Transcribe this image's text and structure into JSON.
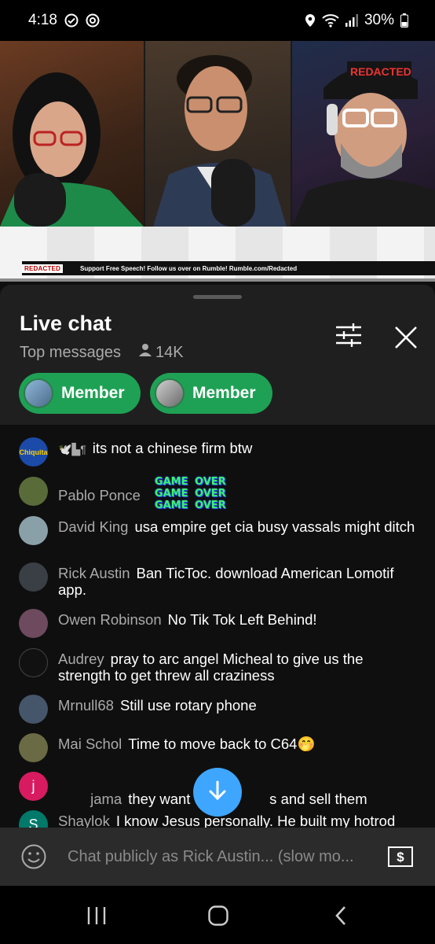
{
  "status_bar": {
    "time": "4:18",
    "battery": "30%"
  },
  "video": {
    "ticker_logo": "REDACTED",
    "ticker_text": "Support Free Speech! Follow us over on Rumble! Rumble.com/Redacted",
    "cap_text": "REDACTED"
  },
  "chat": {
    "title": "Live chat",
    "filter_label": "Top messages",
    "viewer_count": "14K",
    "member_chips": [
      {
        "label": "Member"
      },
      {
        "label": "Member"
      }
    ],
    "messages": [
      {
        "author": "",
        "text": "its not a chinese firm btw",
        "avatar_text": "Chiquita",
        "avatar_color": "#1b4aa8",
        "badges": "🕊️▙¶"
      },
      {
        "author": "Pablo Ponce",
        "text": "GAME OVER GAME OVER GAME OVER",
        "avatar_color": "#5a6b3a"
      },
      {
        "author": "David King",
        "text": "usa empire get cia busy vassals might ditch",
        "avatar_color": "#8aa0a8"
      },
      {
        "author": "Rick Austin",
        "text": "Ban TicToc. download American Lomotif app.",
        "avatar_color": "#3a3f45"
      },
      {
        "author": "Owen Robinson",
        "text": "No Tik Tok Left Behind!",
        "avatar_color": "#6e4a5e"
      },
      {
        "author": "Audrey",
        "text": "pray to arc angel Micheal to give us the strength to get threw all craziness",
        "avatar_color": "#111111"
      },
      {
        "author": "Mrnull68",
        "text": "Still use rotary phone",
        "avatar_color": "#45556a"
      },
      {
        "author": "Mai Schol",
        "text": "Time to move back to C64🤭",
        "avatar_color": "#6a6a44"
      },
      {
        "author": "jama",
        "text": "they want own            s and sell them",
        "avatar_text": "j",
        "avatar_color": "#d81b60"
      },
      {
        "author": "Shaylok",
        "text": "I know Jesus personally. He built my hotrod",
        "avatar_text": "S",
        "avatar_color": "#00796b"
      }
    ],
    "input_placeholder": "Chat publicly as Rick Austin... (slow mo..."
  },
  "colors": {
    "accent_green": "#1fa155",
    "scroll_blue": "#3ea6ff",
    "sheet_bg": "#1f1f1f"
  },
  "icons": [
    "check-circle-icon",
    "threads-icon",
    "location-icon",
    "wifi-icon",
    "signal-icon",
    "battery-icon",
    "person-icon",
    "filter-icon",
    "close-icon",
    "arrow-down-icon",
    "emoji-icon",
    "super-chat-icon",
    "recents-icon",
    "home-icon",
    "back-icon"
  ]
}
